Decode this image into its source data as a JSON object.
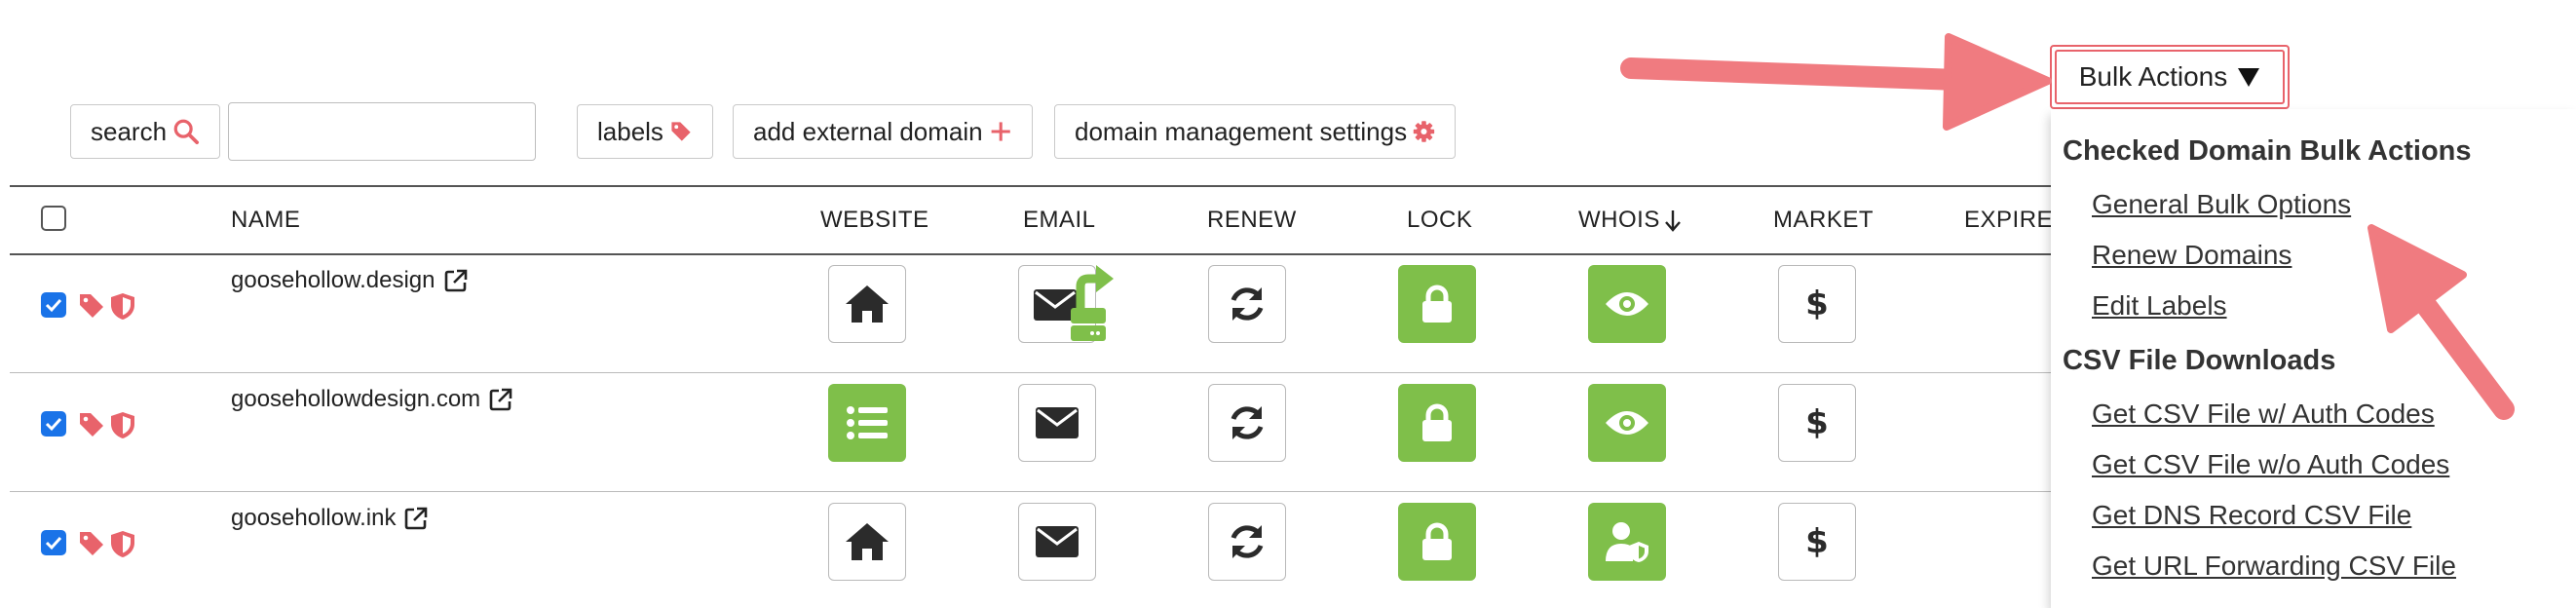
{
  "toolbar": {
    "search_label": "search",
    "search_value": "",
    "labels_label": "labels",
    "add_domain_label": "add external domain",
    "settings_label": "domain management settings",
    "bulk_actions_label": "Bulk Actions"
  },
  "table": {
    "columns": [
      "NAME",
      "WEBSITE",
      "EMAIL",
      "RENEW",
      "LOCK",
      "WHOIS",
      "MARKET",
      "EXPIRES"
    ],
    "rows": [
      {
        "domain": "goosehollow.design",
        "checked": true,
        "website": "home",
        "email": "mail-forwarded",
        "renew": "sync",
        "lock": "locked",
        "whois": "eye",
        "market": "dollar"
      },
      {
        "domain": "goosehollowdesign.com",
        "checked": true,
        "website": "list",
        "email": "mail",
        "renew": "sync",
        "lock": "locked",
        "whois": "eye",
        "market": "dollar"
      },
      {
        "domain": "goosehollow.ink",
        "checked": true,
        "website": "home",
        "email": "mail",
        "renew": "sync",
        "lock": "locked",
        "whois": "user-shield",
        "market": "dollar"
      }
    ]
  },
  "bulk_menu": {
    "checked_heading": "Checked Domain Bulk Actions",
    "checked_items": [
      "General Bulk Options",
      "Renew Domains",
      "Edit Labels"
    ],
    "csv_heading": "CSV File Downloads",
    "csv_items": [
      "Get CSV File w/ Auth Codes",
      "Get CSV File w/o Auth Codes",
      "Get DNS Record CSV File",
      "Get URL Forwarding CSV File"
    ]
  },
  "colors": {
    "accent_red": "#e8636b",
    "green": "#7fbf4a",
    "arrow": "#f07b80",
    "checkbox_blue": "#1a73e8"
  }
}
